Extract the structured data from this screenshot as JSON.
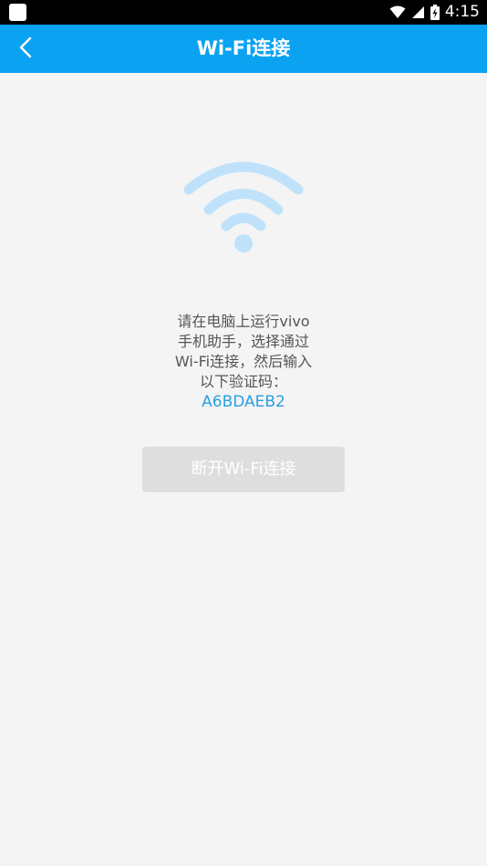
{
  "status_bar": {
    "time": "4:15",
    "icons": [
      "notification-square-icon",
      "wifi-signal-icon",
      "cell-signal-icon",
      "battery-charging-icon"
    ]
  },
  "header": {
    "back_icon": "chevron-left-icon",
    "title": "Wi-Fi连接",
    "background_color": "#0ba2f2"
  },
  "main": {
    "illustration_icon": "wifi-icon",
    "instruction_lines": [
      "请在电脑上运行vivo",
      "手机助手，选择通过",
      "Wi-Fi连接，然后输入",
      "以下验证码："
    ],
    "verification_code": "A6BDAEB2",
    "code_color": "#2a9fe6",
    "disconnect_button_label": "断开Wi-Fi连接"
  }
}
